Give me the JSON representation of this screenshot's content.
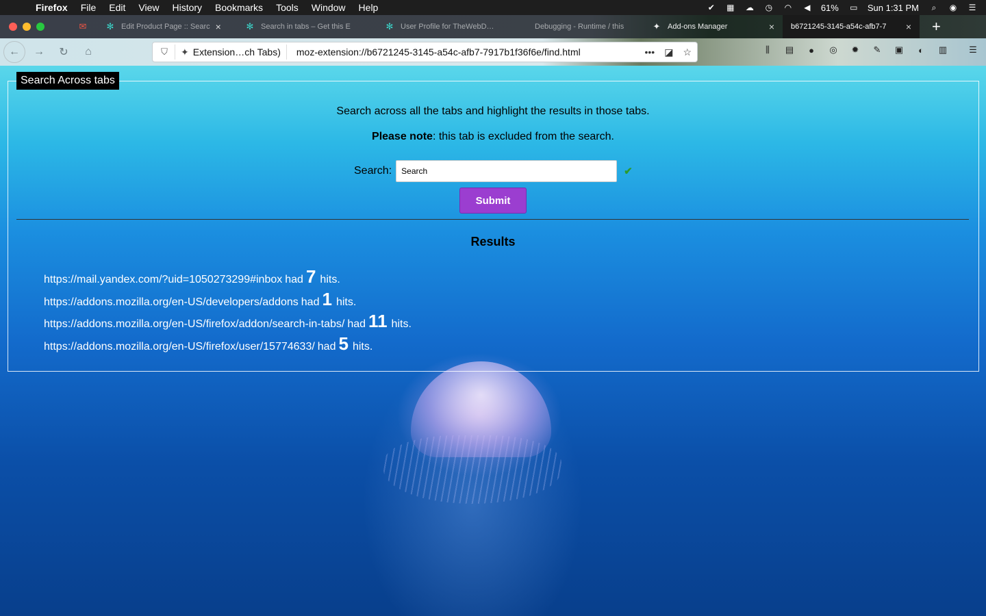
{
  "menubar": {
    "app": "Firefox",
    "items": [
      "File",
      "Edit",
      "View",
      "History",
      "Bookmarks",
      "Tools",
      "Window",
      "Help"
    ],
    "battery": "61%",
    "clock": "Sun 1:31 PM"
  },
  "tabs": [
    {
      "label": "",
      "icon": "mail-icon"
    },
    {
      "label": "Edit Product Page :: Searc",
      "icon": "extension-icon"
    },
    {
      "label": "Search in tabs – Get this E",
      "icon": "extension-icon"
    },
    {
      "label": "User Profile for TheWebD…",
      "icon": "extension-icon"
    },
    {
      "label": "Debugging - Runtime / this",
      "icon": "debug-icon"
    },
    {
      "label": "Add-ons Manager",
      "icon": "puzzle-icon"
    },
    {
      "label": "b6721245-3145-a54c-afb7-7",
      "icon": ""
    }
  ],
  "urlbar": {
    "identity": "Extension…ch Tabs)",
    "url": "moz-extension://b6721245-3145-a54c-afb7-7917b1f36f6e/find.html"
  },
  "page": {
    "legend": "Search Across tabs",
    "intro": "Search across all the tabs and highlight the results in those tabs.",
    "note_bold": "Please note",
    "note_rest": ": this tab is excluded from the search.",
    "search_label": "Search:",
    "search_value": "Search",
    "submit_label": "Submit",
    "results_title": "Results",
    "results": [
      {
        "url": "https://mail.yandex.com/?uid=1050273299#inbox",
        "count": "7"
      },
      {
        "url": "https://addons.mozilla.org/en-US/developers/addons",
        "count": "1"
      },
      {
        "url": "https://addons.mozilla.org/en-US/firefox/addon/search-in-tabs/",
        "count": "11"
      },
      {
        "url": "https://addons.mozilla.org/en-US/firefox/user/15774633/",
        "count": "5"
      }
    ],
    "had": "had",
    "hits": "hits."
  }
}
